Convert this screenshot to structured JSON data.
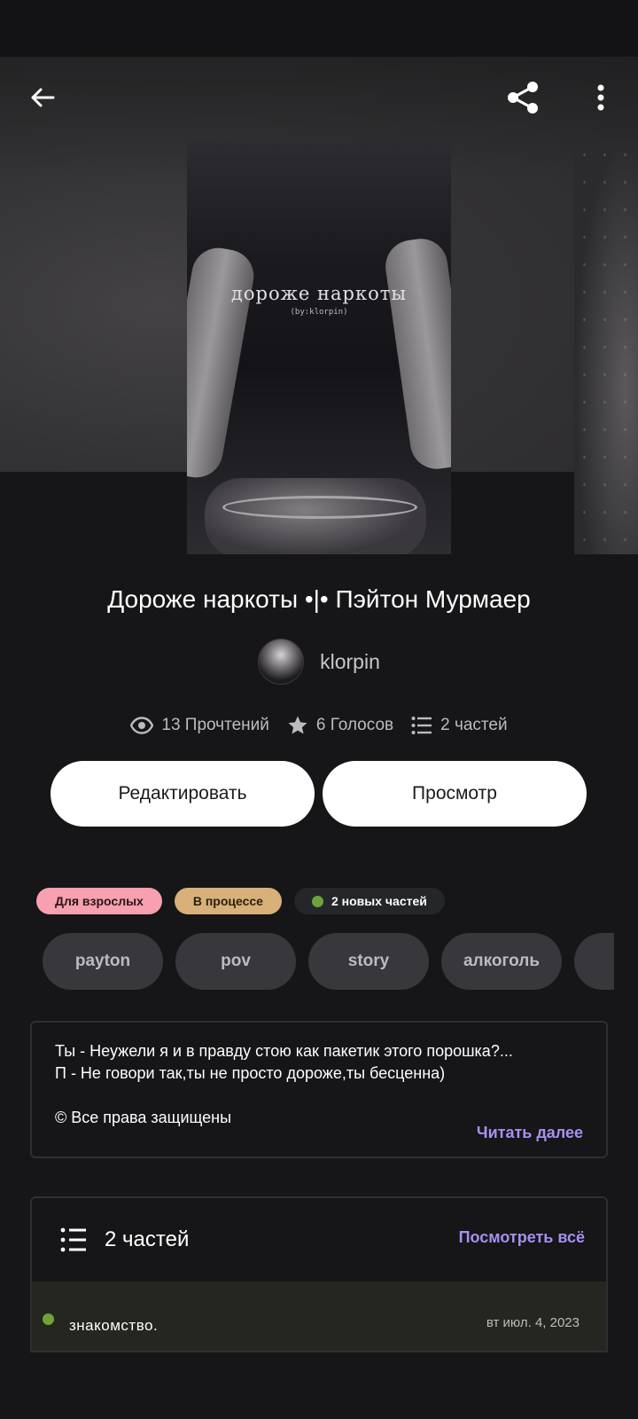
{
  "story": {
    "title": "Дороже наркоты •|• Пэйтон Мурмаер",
    "cover_title": "дороже наркоты",
    "cover_subtitle": "(by:klorpin)",
    "author": "klorpin"
  },
  "stats": {
    "reads": "13 Прочтений",
    "votes": "6 Голосов",
    "parts": "2 частей"
  },
  "actions": {
    "edit_label": "Редактировать",
    "view_label": "Просмотр"
  },
  "badges": {
    "adult": "Для взрослых",
    "status": "В процессе",
    "new_parts": "2 новых частей"
  },
  "tags": [
    "payton",
    "pov",
    "story",
    "алкоголь",
    ""
  ],
  "description": {
    "text": "Ты - Неужели я и в правду стою как пакетик этого порошка?...\nП - Не говори так,ты не просто дороже,ты бесценна)\n\n© Все права защищены",
    "read_more": "Читать далее"
  },
  "parts_section": {
    "title": "2 частей",
    "see_all": "Посмотреть всё",
    "items": [
      {
        "name": "знакомство.",
        "date": "вт июл. 4, 2023"
      }
    ]
  },
  "icons": {
    "back": "arrow-left-icon",
    "share": "share-icon",
    "more": "more-vertical-icon",
    "reads": "eye-icon",
    "votes": "star-icon",
    "parts": "list-icon"
  },
  "colors": {
    "background": "#161517",
    "accent_link": "#a88ff0",
    "badge_adult": "#f6a0b0",
    "badge_progress": "#d7b07a",
    "new_dot": "#6fa33a"
  }
}
